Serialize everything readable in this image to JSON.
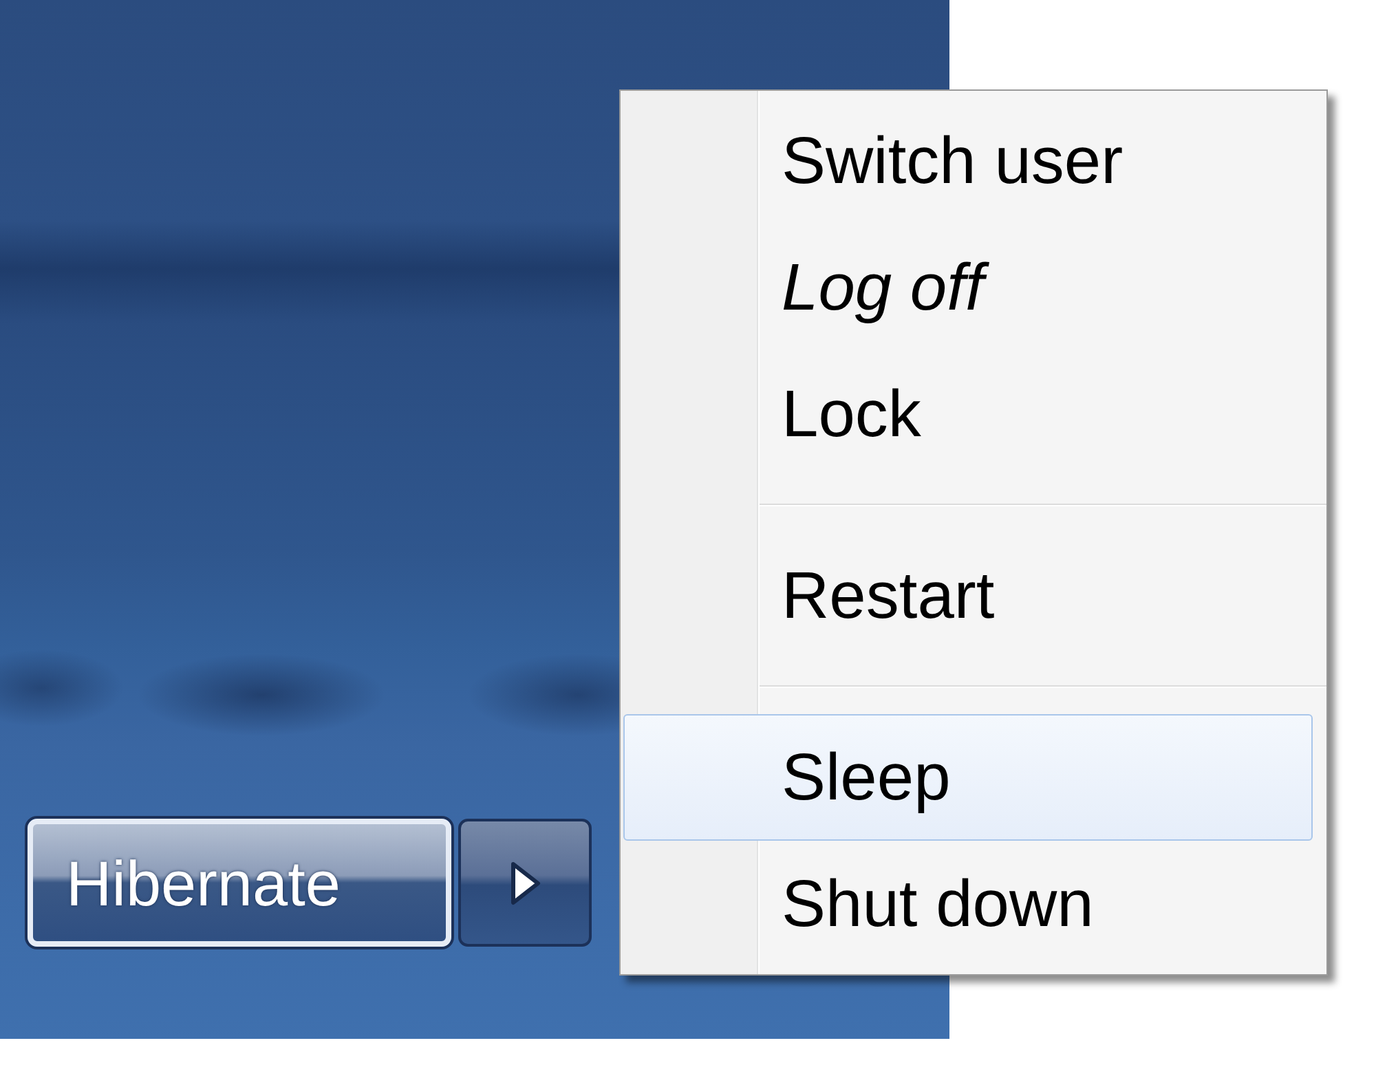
{
  "start_menu": {
    "power_button": {
      "label": "Hibernate"
    }
  },
  "power_menu": {
    "items": [
      {
        "kind": "item",
        "label": "Switch user",
        "selected": false,
        "italic": false
      },
      {
        "kind": "item",
        "label": "Log off",
        "selected": false,
        "italic": true
      },
      {
        "kind": "item",
        "label": "Lock",
        "selected": false,
        "italic": false
      },
      {
        "kind": "separator"
      },
      {
        "kind": "item",
        "label": "Restart",
        "selected": false,
        "italic": false
      },
      {
        "kind": "separator"
      },
      {
        "kind": "item",
        "label": "Sleep",
        "selected": true,
        "italic": false
      },
      {
        "kind": "item",
        "label": "Shut down",
        "selected": false,
        "italic": false
      }
    ]
  }
}
